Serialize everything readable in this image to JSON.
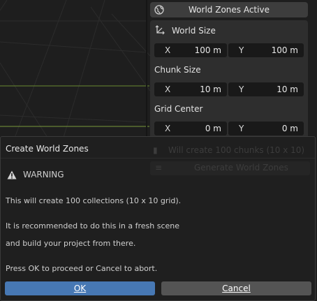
{
  "panel": {
    "header_title": "World Zones Active",
    "header_icon": "globe-icon",
    "sections": {
      "world_size": {
        "title": "World Size",
        "icon": "axis-icon",
        "x_label": "X",
        "x_value": "100 m",
        "y_label": "Y",
        "y_value": "100 m"
      },
      "chunk_size": {
        "title": "Chunk Size",
        "x_label": "X",
        "x_value": "10 m",
        "y_label": "Y",
        "y_value": "10 m"
      },
      "grid_center": {
        "title": "Grid Center",
        "x_label": "X",
        "x_value": "0 m",
        "y_label": "Y",
        "y_value": "0 m"
      }
    },
    "obscured_info": "Will create 100 chunks (10 x 10)",
    "obscured_button": "Generate World Zones"
  },
  "dialog": {
    "title": "Create World Zones",
    "warning_icon": "warning-icon",
    "warning_label": "WARNING",
    "lines": [
      "This will create 100 collections (10 x 10 grid).",
      "It is recommended to do this in a fresh scene",
      "and build your project from there.",
      "Press OK to proceed or Cancel to abort."
    ],
    "ok_label": "OK",
    "cancel_label": "Cancel"
  },
  "colors": {
    "accent": "#4778b4",
    "panel_bg": "#2e2e2e",
    "field_bg": "#191919",
    "dialog_bg": "#1f1f1f"
  }
}
